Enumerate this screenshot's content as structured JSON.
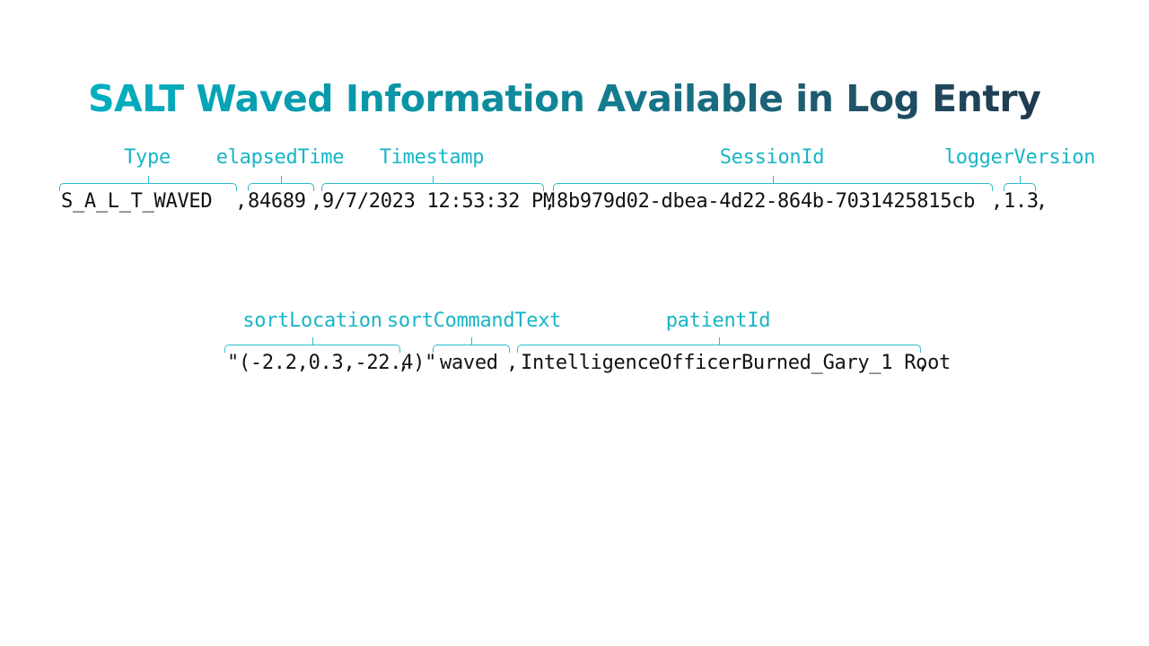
{
  "title": "SALT Waved Information Available in Log Entry",
  "row1": {
    "labels": {
      "type": "Type",
      "elapsed_time": "elapsedTime",
      "timestamp": "Timestamp",
      "session_id": "SessionId",
      "logger_version": "loggerVersion"
    },
    "values": {
      "type": "S_A_L_T_WAVED",
      "elapsed_time": "84689",
      "timestamp": "9/7/2023 12:53:32 PM",
      "session_id": "8b979d02-dbea-4d22-864b-7031425815cb",
      "logger_version": "1.3"
    }
  },
  "row2": {
    "labels": {
      "sort_location": "sortLocation",
      "sort_command_text": "sortCommandText",
      "patient_id": "patientId"
    },
    "values": {
      "sort_location": "\"(-2.2,0.3,-22.4)\"",
      "sort_command_text": "waved",
      "patient_id": "IntelligenceOfficerBurned_Gary_1 Root"
    }
  },
  "separator": ",",
  "accent_color": "#18b5c6",
  "title_gradient": [
    "#00afc0",
    "#20394d"
  ]
}
